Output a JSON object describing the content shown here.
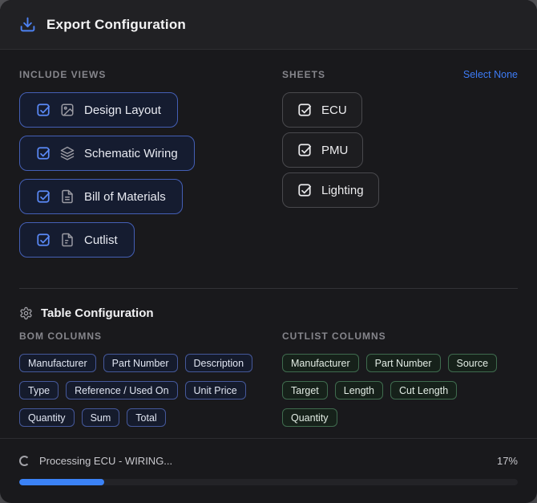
{
  "header": {
    "title": "Export Configuration"
  },
  "include_views": {
    "label": "INCLUDE VIEWS",
    "items": [
      {
        "label": "Design Layout",
        "icon": "image-icon",
        "checked": true
      },
      {
        "label": "Schematic Wiring",
        "icon": "layers-icon",
        "checked": true
      },
      {
        "label": "Bill of Materials",
        "icon": "file-text-icon",
        "checked": true
      },
      {
        "label": "Cutlist",
        "icon": "file-icon",
        "checked": true
      }
    ]
  },
  "sheets": {
    "label": "SHEETS",
    "select_none_label": "Select None",
    "items": [
      {
        "label": "ECU",
        "checked": true
      },
      {
        "label": "PMU",
        "checked": true
      },
      {
        "label": "Lighting",
        "checked": true
      }
    ]
  },
  "table_configuration": {
    "title": "Table Configuration",
    "bom_columns": {
      "label": "BOM COLUMNS",
      "items": [
        "Manufacturer",
        "Part Number",
        "Description",
        "Type",
        "Reference / Used On",
        "Unit Price",
        "Quantity",
        "Sum",
        "Total"
      ]
    },
    "cutlist_columns": {
      "label": "CUTLIST COLUMNS",
      "items": [
        "Manufacturer",
        "Part Number",
        "Source",
        "Target",
        "Length",
        "Cut Length",
        "Quantity"
      ]
    }
  },
  "progress": {
    "status": "Processing ECU - WIRING...",
    "percent": 17,
    "percent_label": "17%"
  },
  "colors": {
    "accent_blue": "#3b82f6",
    "view_button_border": "#445fb5",
    "cutlist_chip_border": "#3f6b4e",
    "link_blue": "#3d7bf5"
  }
}
